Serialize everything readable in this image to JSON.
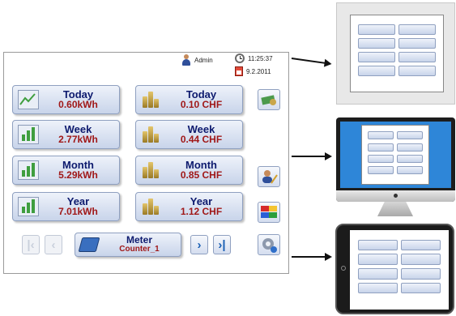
{
  "header": {
    "user": "Admin",
    "time": "11:25:37",
    "date": "9.2.2011"
  },
  "tiles": [
    {
      "label": "Today",
      "value": "0.60kWh",
      "icon": "trend-chart-icon"
    },
    {
      "label": "Today",
      "value": "0.10 CHF",
      "icon": "coins-icon"
    },
    {
      "label": "Week",
      "value": "2.77kWh",
      "icon": "bar-chart-icon"
    },
    {
      "label": "Week",
      "value": "0.44 CHF",
      "icon": "coins-icon"
    },
    {
      "label": "Month",
      "value": "5.29kWh",
      "icon": "bar-chart-icon"
    },
    {
      "label": "Month",
      "value": "0.85 CHF",
      "icon": "coins-icon"
    },
    {
      "label": "Year",
      "value": "7.01kWh",
      "icon": "bar-chart-icon"
    },
    {
      "label": "Year",
      "value": "1.12 CHF",
      "icon": "coins-icon"
    }
  ],
  "meter": {
    "label": "Meter",
    "value": "Counter_1"
  },
  "colors": {
    "label": "#0d1a6e",
    "value": "#a01818",
    "tile": "#c8d4ea",
    "monitor_screen": "#2e86d8"
  }
}
